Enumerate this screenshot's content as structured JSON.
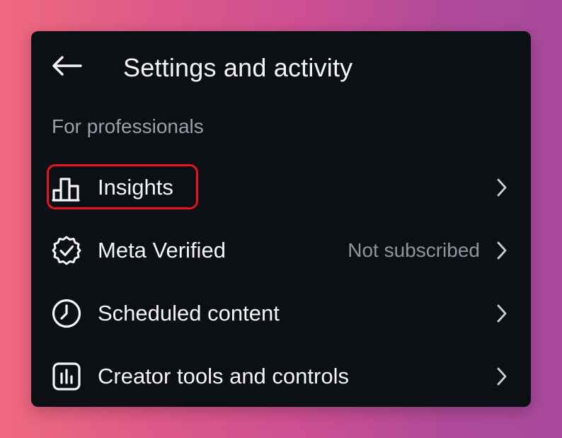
{
  "header": {
    "title": "Settings and activity",
    "back_icon": "arrow-left-icon"
  },
  "section": {
    "label": "For professionals"
  },
  "items": [
    {
      "label": "Insights",
      "icon": "bar-chart-icon",
      "value": "",
      "highlighted": true
    },
    {
      "label": "Meta Verified",
      "icon": "verified-badge-icon",
      "value": "Not subscribed",
      "highlighted": false
    },
    {
      "label": "Scheduled content",
      "icon": "clock-icon",
      "value": "",
      "highlighted": false
    },
    {
      "label": "Creator tools and controls",
      "icon": "chart-box-icon",
      "value": "",
      "highlighted": false
    }
  ],
  "colors": {
    "background_left": "#ef6a7e",
    "background_right": "#a8499c",
    "panel": "#0c0f14",
    "text": "#f5f5f5",
    "muted_text": "#9aa1ab",
    "highlight": "#e8141f"
  }
}
